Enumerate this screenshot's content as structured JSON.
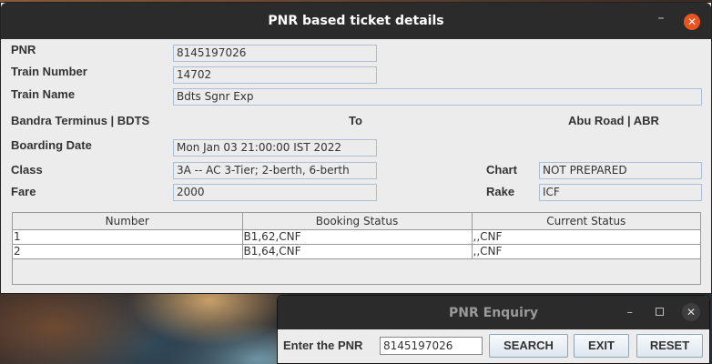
{
  "main_window": {
    "title": "PNR based ticket details",
    "pnr_label": "PNR",
    "pnr_value": "8145197026",
    "train_number_label": "Train Number",
    "train_number_value": "14702",
    "train_name_label": "Train Name",
    "train_name_value": "Bdts Sgnr Exp",
    "from_station": "Bandra Terminus | BDTS",
    "to_label": "To",
    "to_station": "Abu Road | ABR",
    "boarding_date_label": "Boarding Date",
    "boarding_date_value": "Mon Jan 03 21:00:00 IST 2022",
    "class_label": "Class",
    "class_value": "3A -- AC 3-Tier; 2-berth, 6-berth",
    "fare_label": "Fare",
    "fare_value": "2000",
    "chart_label": "Chart",
    "chart_value": "NOT PREPARED",
    "rake_label": "Rake",
    "rake_value": "ICF",
    "table": {
      "headers": [
        "Number",
        "Booking Status",
        "Current Status"
      ],
      "rows": [
        [
          "1",
          "B1,62,CNF",
          ",,CNF"
        ],
        [
          "2",
          "B1,64,CNF",
          ",,CNF"
        ]
      ]
    }
  },
  "enquiry_window": {
    "title": "PNR Enquiry",
    "label": "Enter the PNR",
    "input_value": "8145197026",
    "search_label": "SEARCH",
    "exit_label": "EXIT",
    "reset_label": "RESET"
  },
  "colors": {
    "titlebar": "#2b2b2b",
    "close_button": "#e95420",
    "field_border": "#a9bfd6"
  }
}
